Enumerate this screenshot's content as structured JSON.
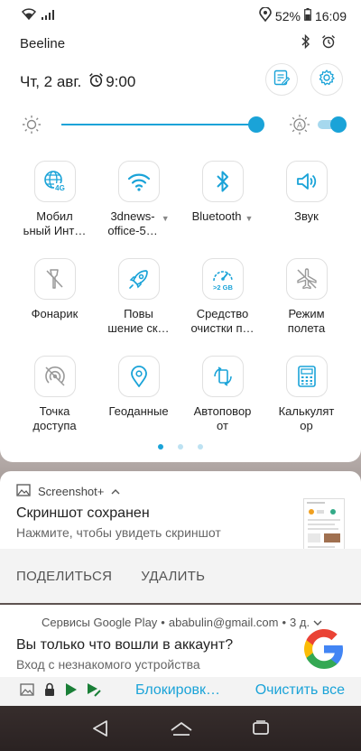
{
  "status_bar": {
    "battery_percent": "52%",
    "time": "16:09"
  },
  "carrier": "Beeline",
  "date": {
    "date_text": "Чт, 2 авг.",
    "alarm_time": "9:00"
  },
  "brightness": {
    "level_fraction": 0.9,
    "auto_enabled": true
  },
  "tiles": [
    [
      {
        "name": "tile-mobile-internet",
        "icon": "globe-4g-icon",
        "label": "Мобил\nьный Инт…",
        "dropdown": false
      },
      {
        "name": "tile-wifi",
        "icon": "wifi-icon",
        "label": "3dnews-\noffice-5…",
        "dropdown": true
      },
      {
        "name": "tile-bluetooth",
        "icon": "bluetooth-icon",
        "label": "Bluetooth",
        "dropdown": true
      },
      {
        "name": "tile-sound",
        "icon": "speaker-icon",
        "label": "Звук",
        "dropdown": false
      }
    ],
    [
      {
        "name": "tile-flashlight",
        "icon": "flashlight-icon",
        "label": "Фонарик",
        "dropdown": false
      },
      {
        "name": "tile-boost",
        "icon": "rocket-icon",
        "label": "Повы\nшение ск…",
        "dropdown": false
      },
      {
        "name": "tile-cleaner",
        "icon": "gauge-icon",
        "label": "Средство\nочистки п…",
        "dropdown": false,
        "badge": ">2 GB"
      },
      {
        "name": "tile-airplane",
        "icon": "airplane-icon",
        "label": "Режим\nполета",
        "dropdown": false
      }
    ],
    [
      {
        "name": "tile-hotspot",
        "icon": "hotspot-icon",
        "label": "Точка\nдоступа",
        "dropdown": false
      },
      {
        "name": "tile-location",
        "icon": "location-icon",
        "label": "Геоданные",
        "dropdown": false
      },
      {
        "name": "tile-autorotate",
        "icon": "rotate-icon",
        "label": "Автоповор\nот",
        "dropdown": false
      },
      {
        "name": "tile-calculator",
        "icon": "calculator-icon",
        "label": "Калькулят\nор",
        "dropdown": false
      }
    ]
  ],
  "notif1": {
    "app": "Screenshot+",
    "title": "Скриншот сохранен",
    "subtitle": "Нажмите, чтобы увидеть скриншот",
    "action_share": "ПОДЕЛИТЬСЯ",
    "action_delete": "УДАЛИТЬ"
  },
  "notif2": {
    "app": "Сервисы Google Play",
    "account": "ababulin@gmail.com",
    "when": "3 д.",
    "title": "Вы только что вошли в аккаунт?",
    "subtitle": "Вход с незнакомого устройства",
    "action_block": "Блокировк…",
    "action_clear": "Очистить все"
  },
  "colors": {
    "accent": "#1aa3d8"
  }
}
